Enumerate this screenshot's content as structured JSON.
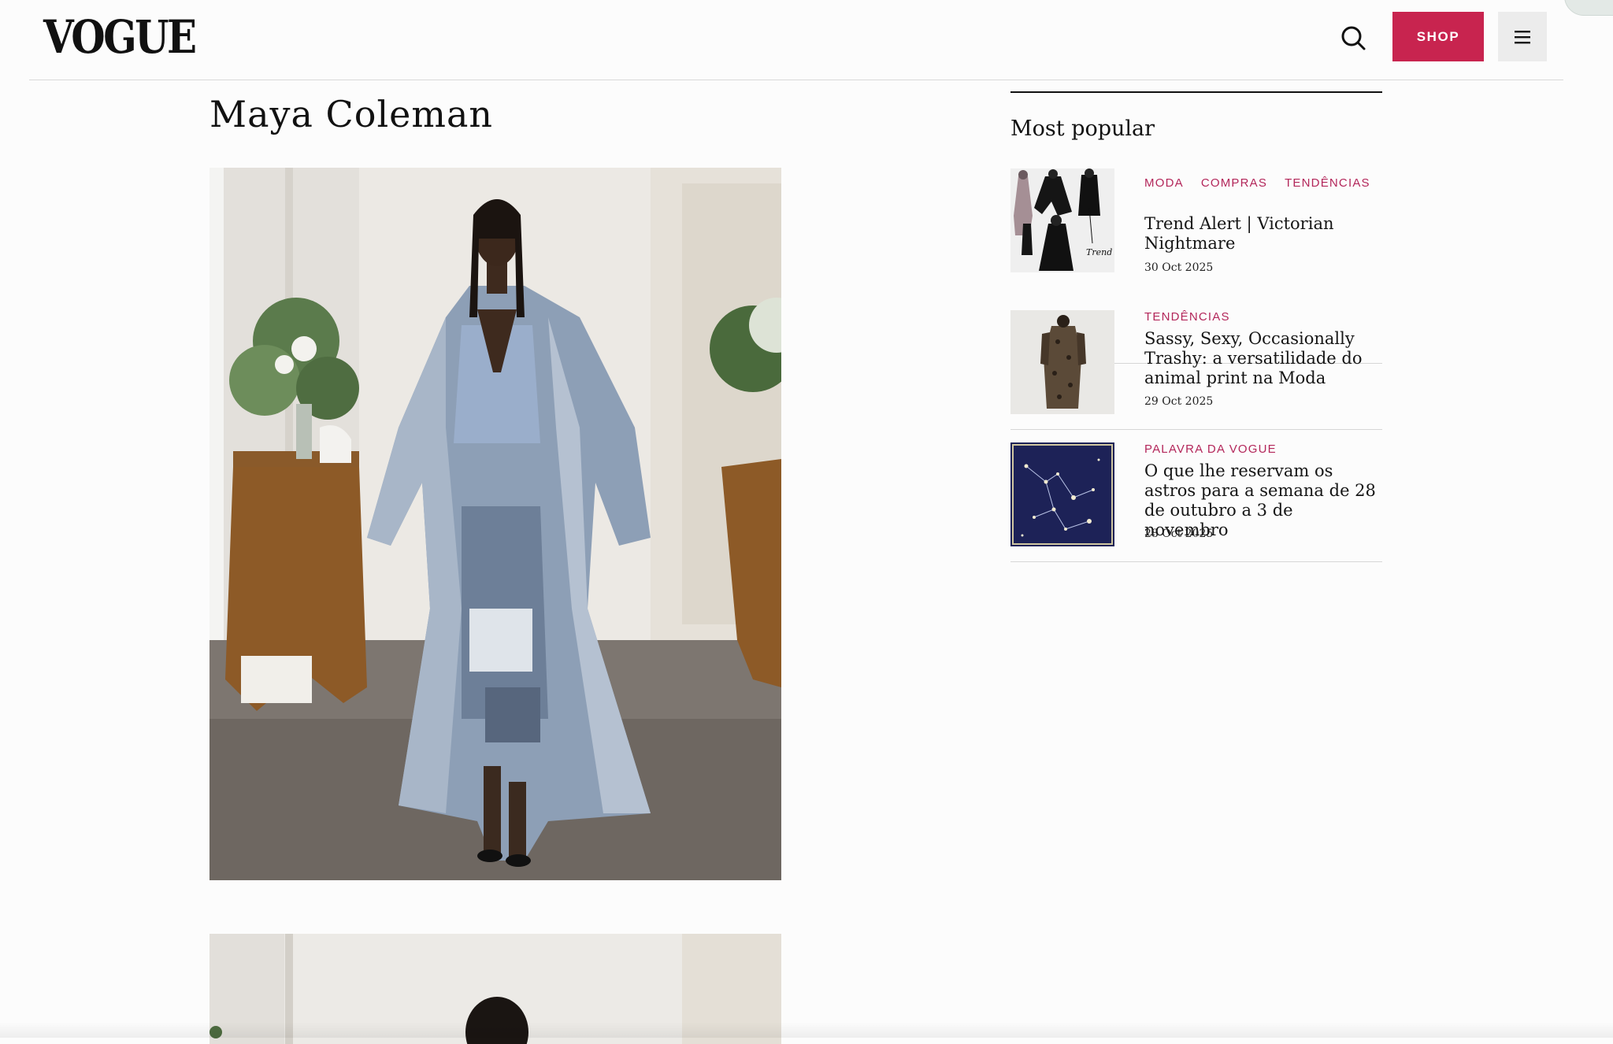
{
  "header": {
    "logo": "VOGUE",
    "search_icon": "search-icon",
    "shop_label": "SHOP",
    "menu_icon": "hamburger-icon",
    "brand_color": "#c8244f"
  },
  "main": {
    "title": "Maya Coleman"
  },
  "sidebar": {
    "title": "Most popular",
    "tag_color": "#b3265a",
    "items": [
      {
        "tags": [
          "MODA",
          "COMPRAS",
          "TENDÊNCIAS"
        ],
        "headline": "Trend Alert | Victorian Nightmare",
        "date": "30 Oct 2025",
        "thumb_text": "Trend Alert"
      },
      {
        "tags": [
          "TENDÊNCIAS"
        ],
        "headline": "Sassy, Sexy, Occasionally Trashy: a versatilidade do animal print na Moda",
        "date": "29 Oct 2025"
      },
      {
        "tags": [
          "PALAVRA DA VOGUE"
        ],
        "headline": "O que lhe reservam os astros para a semana de 28 de outubro a 3 de novembro",
        "date": "28 Oct 2025"
      }
    ]
  }
}
